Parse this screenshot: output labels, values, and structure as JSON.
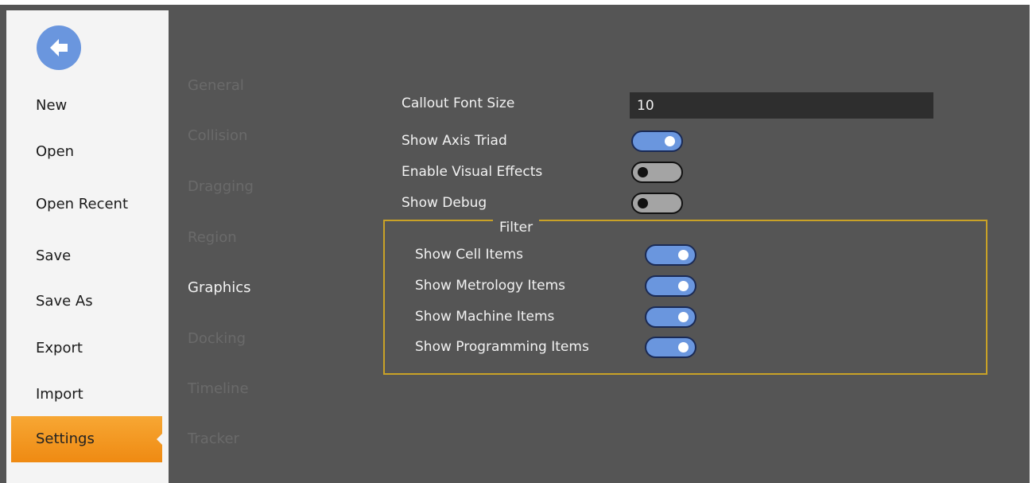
{
  "backstage": {
    "back_icon": "arrow-left-circle-icon",
    "items": [
      {
        "label": "New"
      },
      {
        "label": "Open"
      },
      {
        "label": "Open Recent"
      },
      {
        "label": "Save"
      },
      {
        "label": "Save As"
      },
      {
        "label": "Export"
      },
      {
        "label": "Import"
      },
      {
        "label": "Settings",
        "active": true
      }
    ],
    "active_color": "#ef8a12"
  },
  "categories": [
    {
      "label": "General"
    },
    {
      "label": "Collision"
    },
    {
      "label": "Dragging"
    },
    {
      "label": "Region"
    },
    {
      "label": "Graphics",
      "active": true
    },
    {
      "label": "Docking"
    },
    {
      "label": "Timeline"
    },
    {
      "label": "Tracker"
    }
  ],
  "settings": {
    "callout_font_size": {
      "label": "Callout Font Size",
      "value": "10"
    },
    "show_axis_triad": {
      "label": "Show Axis Triad",
      "on": true
    },
    "enable_visual_effects": {
      "label": "Enable Visual Effects",
      "on": false
    },
    "show_debug": {
      "label": "Show Debug",
      "on": false
    }
  },
  "filter": {
    "title": "Filter",
    "items": [
      {
        "label": "Show Cell Items",
        "on": true
      },
      {
        "label": "Show Metrology Items",
        "on": true
      },
      {
        "label": "Show Machine Items",
        "on": true
      },
      {
        "label": "Show Programming Items",
        "on": true
      }
    ]
  },
  "colors": {
    "background": "#555555",
    "toggle_on": "#6a96de",
    "filter_border": "#c9a227"
  }
}
